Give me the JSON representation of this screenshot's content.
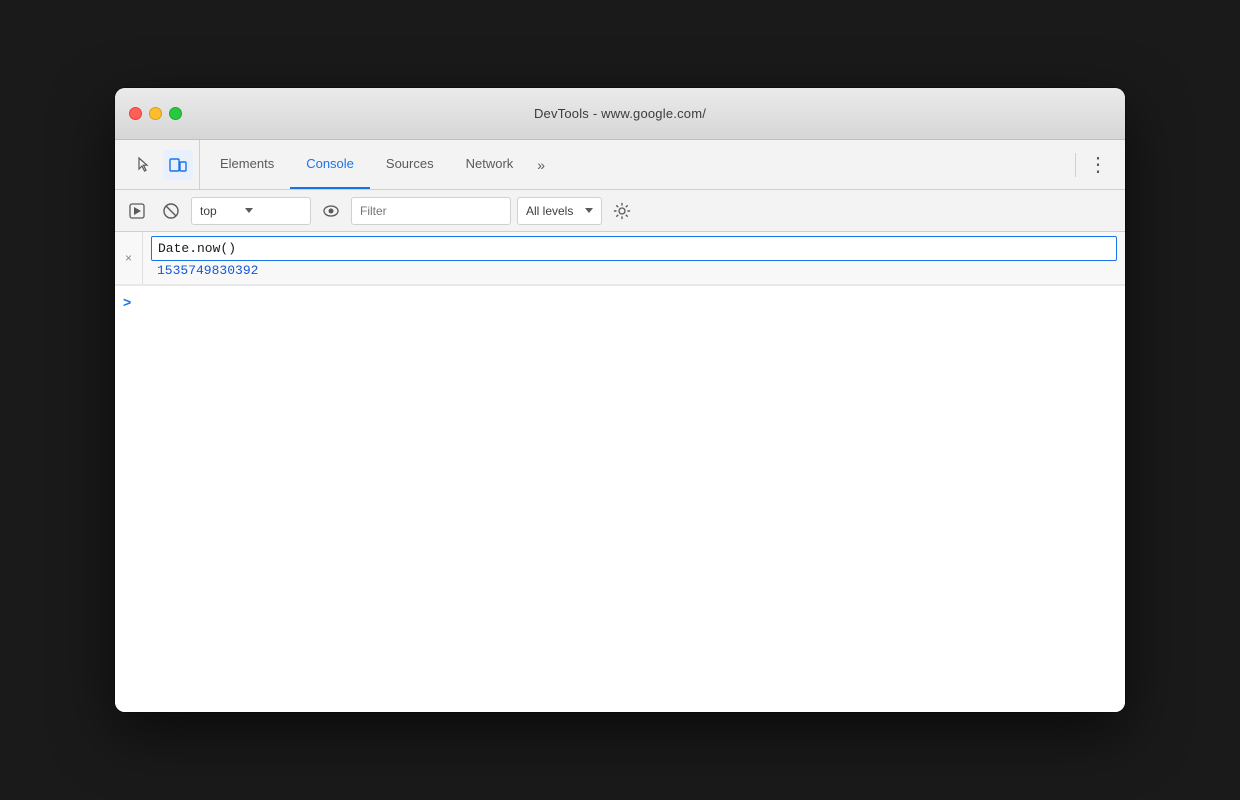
{
  "window": {
    "title": "DevTools - www.google.com/"
  },
  "traffic_lights": {
    "close_label": "close",
    "minimize_label": "minimize",
    "maximize_label": "maximize"
  },
  "tabs": {
    "items": [
      {
        "id": "elements",
        "label": "Elements"
      },
      {
        "id": "console",
        "label": "Console"
      },
      {
        "id": "sources",
        "label": "Sources"
      },
      {
        "id": "network",
        "label": "Network"
      }
    ],
    "active": "console",
    "more_label": "»",
    "kebab_label": "⋮"
  },
  "toolbar": {
    "context": {
      "value": "top",
      "placeholder": "top"
    },
    "filter": {
      "placeholder": "Filter"
    },
    "levels": {
      "label": "All levels"
    }
  },
  "console": {
    "entry": {
      "close_label": "×",
      "input_value": "Date.now()",
      "result_value": "1535749830392"
    },
    "prompt_arrow": ">"
  },
  "colors": {
    "active_tab": "#1a73e8",
    "result_color": "#1558d6",
    "prompt_color": "#1a73e8"
  }
}
